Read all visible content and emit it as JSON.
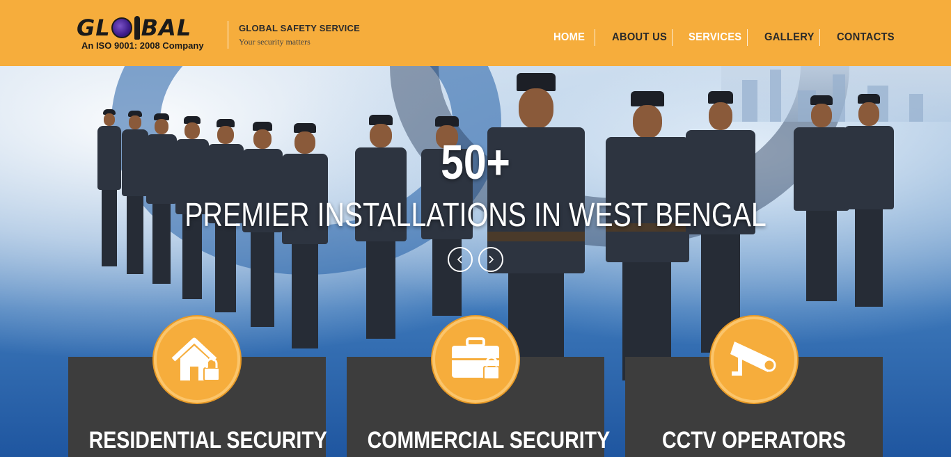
{
  "header": {
    "logo_text_1": "GL",
    "logo_text_2": "BAL",
    "logo_tagline": "An ISO 9001: 2008 Company",
    "brand_name": "GLOBAL SAFETY SERVICE",
    "brand_subtitle": "Your security matters"
  },
  "nav": {
    "items": [
      {
        "label": "HOME",
        "active": true
      },
      {
        "label": "ABOUT US",
        "active": false
      },
      {
        "label": "SERVICES",
        "active": true
      },
      {
        "label": "GALLERY",
        "active": false
      },
      {
        "label": "CONTACTS",
        "active": false
      }
    ]
  },
  "hero": {
    "stat": "50+",
    "headline": "PREMIER INSTALLATIONS IN WEST BENGAL",
    "prev_icon": "chevron-left-icon",
    "next_icon": "chevron-right-icon"
  },
  "services": [
    {
      "title": "RESIDENTIAL SECURITY",
      "icon": "house-lock-icon"
    },
    {
      "title": "COMMERCIAL SECURITY",
      "icon": "briefcase-lock-icon"
    },
    {
      "title": "CCTV OPERATORS",
      "icon": "cctv-camera-icon"
    }
  ],
  "colors": {
    "header_bg": "#f6ad3c",
    "card_bg": "#3d3d3d",
    "accent": "#f6ad3c"
  }
}
